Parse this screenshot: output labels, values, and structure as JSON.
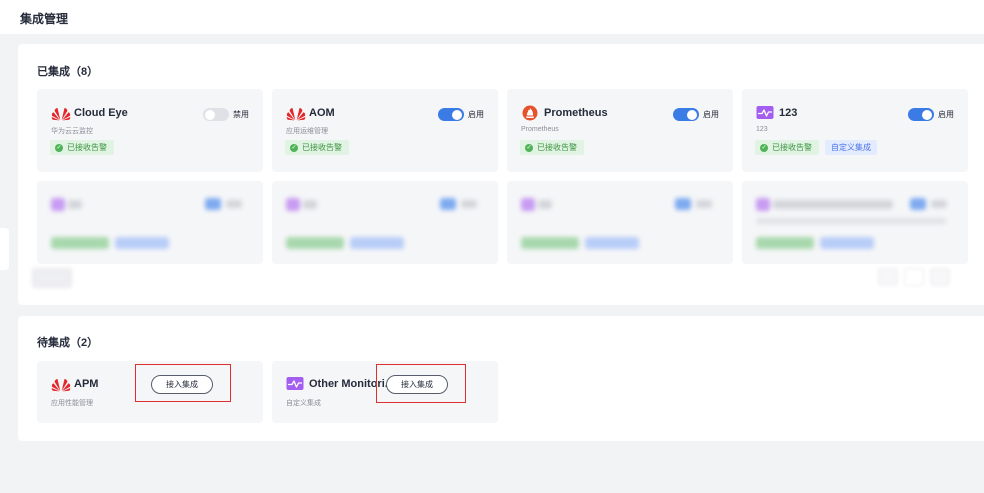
{
  "page": {
    "title": "集成管理"
  },
  "integrated": {
    "title": "已集成（8）",
    "cards": [
      {
        "name": "Cloud Eye",
        "desc": "华为云云监控",
        "logo": "huawei-logo",
        "toggle_on": false,
        "toggle_label": "禁用",
        "tags": [
          "已接收告警"
        ]
      },
      {
        "name": "AOM",
        "desc": "应用运维管理",
        "logo": "huawei-logo",
        "toggle_on": true,
        "toggle_label": "启用",
        "tags": [
          "已接收告警"
        ]
      },
      {
        "name": "Prometheus",
        "desc": "Prometheus",
        "logo": "prometheus-logo",
        "toggle_on": true,
        "toggle_label": "启用",
        "tags": [
          "已接收告警"
        ]
      },
      {
        "name": "123",
        "desc": "123",
        "logo": "custom-monitor-logo",
        "toggle_on": true,
        "toggle_label": "启用",
        "tags": [
          "已接收告警",
          "自定义集成"
        ]
      }
    ]
  },
  "pending": {
    "title": "待集成（2）",
    "cards": [
      {
        "name": "APM",
        "desc": "应用性能管理",
        "logo": "huawei-logo",
        "button": "接入集成"
      },
      {
        "name": "Other Monitori...",
        "desc": "自定义集成",
        "logo": "custom-monitor-logo",
        "button": "接入集成"
      }
    ]
  },
  "colors": {
    "accent": "#3a7be6",
    "success": "#50b358",
    "tag_blue": "#4c73e8",
    "huawei_red": "#e3262a",
    "prometheus_orange": "#e6522c",
    "highlight_box": "#e02f2f"
  }
}
